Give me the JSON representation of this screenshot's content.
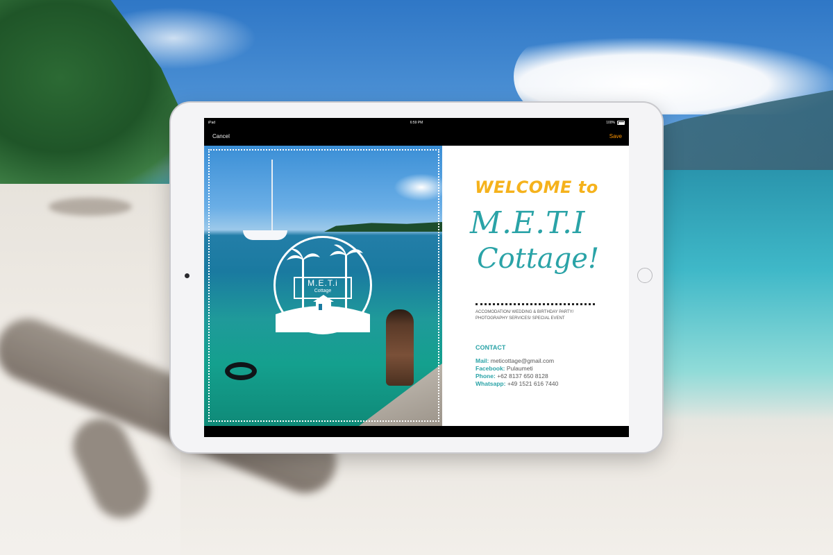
{
  "statusbar": {
    "device": "iPad",
    "time": "6:59 PM",
    "battery": "100%"
  },
  "navbar": {
    "cancel_label": "Cancel",
    "save_label": "Save"
  },
  "logo": {
    "name": "M.E.T.i",
    "sub": "Cottage"
  },
  "welcome": {
    "line": "WELCOME to",
    "brand_line1": "M.E.T.I",
    "brand_line2": "Cottage!"
  },
  "services": "ACCOMODATION/ WEDDING & BIRTHDAY PARTY/ PHOTOGRAPHY SERVICES/ SPECIAL EVENT",
  "contact": {
    "title": "CONTACT",
    "mail_label": "Mail:",
    "mail_value": "meticottage@gmail.com",
    "facebook_label": "Facebook:",
    "facebook_value": "Pulaumeti",
    "phone_label": "Phone:",
    "phone_value": "+62 8137 650 8128",
    "whatsapp_label": "Whatsapp:",
    "whatsapp_value": "+49 1521 616 7440"
  },
  "colors": {
    "teal": "#2aa3a7",
    "gold": "#f5b21c",
    "ios_orange": "#ff9500"
  }
}
